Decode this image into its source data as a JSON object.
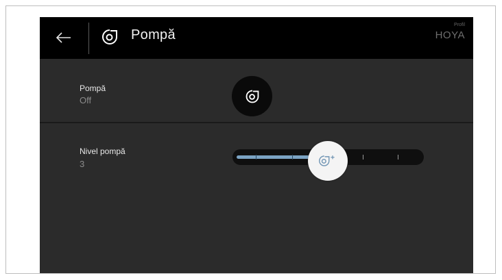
{
  "colors": {
    "background": "#2b2b2b",
    "header": "#000000",
    "accent": "#7ba3c3",
    "handle": "#f4f4f4"
  },
  "header": {
    "back_icon": "arrow-left-icon",
    "icon": "pump-fan-icon",
    "title": "Pompă",
    "profile_label": "Profil",
    "profile_name": "HOYA"
  },
  "rows": [
    {
      "label": "Pompă",
      "value": "Off",
      "control": "toggle-button",
      "icon": "pump-fan-icon"
    },
    {
      "label": "Nivel pompă",
      "value": "3",
      "control": "slider",
      "icon": "pump-fan-icon",
      "level": 3,
      "levels": 6
    }
  ]
}
